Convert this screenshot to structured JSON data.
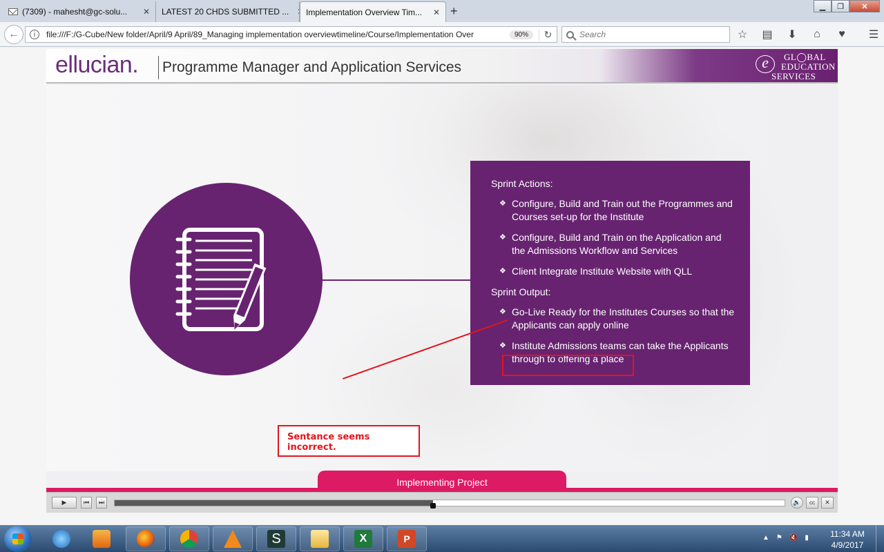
{
  "browser": {
    "tabs": [
      {
        "label": "(7309) - mahesht@gc-solu..."
      },
      {
        "label": "LATEST 20 CHDS SUBMITTED ..."
      },
      {
        "label": "Implementation Overview Tim..."
      }
    ],
    "url": "file:///F:/G-Cube/New folder/April/9 April/89_Managing implementation overviewtimeline/Course/Implementation Over",
    "zoom": "90%",
    "search_placeholder": "Search"
  },
  "course": {
    "brand": "ellucian.",
    "header_title": "Programme Manager and Application Services",
    "logo_lines": [
      "GL◯BAL",
      "EDUCATION",
      "SERVICES"
    ],
    "info": {
      "actions_heading": "Sprint Actions:",
      "actions": [
        "Configure, Build and Train out the Programmes and Courses set-up for the Institute",
        "Configure, Build and Train on the Application and the Admissions Workflow and Services",
        "Client Integrate Institute Website with QLL"
      ],
      "output_heading": "Sprint Output:",
      "outputs": [
        "Go-Live Ready for the Institutes Courses so that the Applicants can apply online",
        "Institute Admissions teams can take the Applicants through to offering a place"
      ]
    },
    "annotation": "Sentance seems incorrect.",
    "footer_tab": "Implementing Project",
    "player": {
      "progress": 0.475
    }
  },
  "colors": {
    "purple": "#672370",
    "pink": "#dd1a64",
    "annotation_red": "#e3141b"
  },
  "taskbar": {
    "time": "11:34 AM",
    "date": "4/9/2017",
    "apps": [
      "windows-explorer-icon",
      "internet-explorer-icon",
      "media-player-icon",
      "firefox-icon",
      "chrome-icon",
      "vlc-icon",
      "sound-app-icon",
      "file-explorer-icon",
      "excel-icon",
      "powerpoint-icon"
    ]
  }
}
